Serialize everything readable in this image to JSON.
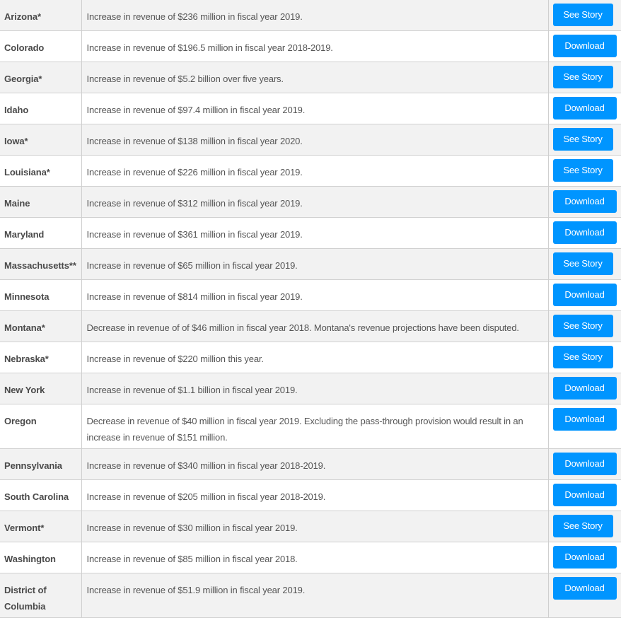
{
  "table": {
    "rows": [
      {
        "name": "Arizona*",
        "description": "Increase in revenue of $236 million in fiscal year 2019.",
        "action": "See Story"
      },
      {
        "name": "Colorado",
        "description": "Increase in revenue of $196.5 million in fiscal year 2018-2019.",
        "action": "Download"
      },
      {
        "name": "Georgia*",
        "description": "Increase in revenue of $5.2 billion over five years.",
        "action": "See Story"
      },
      {
        "name": "Idaho",
        "description": "Increase in revenue of $97.4 million in fiscal year 2019.",
        "action": "Download"
      },
      {
        "name": "Iowa*",
        "description": "Increase in revenue of $138 million in fiscal year 2020.",
        "action": "See Story"
      },
      {
        "name": "Louisiana*",
        "description": "Increase in revenue of $226 million in fiscal year 2019.",
        "action": "See Story"
      },
      {
        "name": "Maine",
        "description": "Increase in revenue of $312 million in fiscal year 2019.",
        "action": "Download"
      },
      {
        "name": "Maryland",
        "description": "Increase in revenue of $361 million in fiscal year 2019.",
        "action": "Download"
      },
      {
        "name": "Massachusetts**",
        "description": "Increase in revenue of $65 million in fiscal year 2019.",
        "action": "See Story"
      },
      {
        "name": "Minnesota",
        "description": "Increase in revenue of $814 million in fiscal year 2019.",
        "action": "Download"
      },
      {
        "name": "Montana*",
        "description": "Decrease in revenue of of $46 million in fiscal year 2018. Montana's revenue projections have been disputed.",
        "action": "See Story"
      },
      {
        "name": "Nebraska*",
        "description": "Increase in revenue of $220 million this year.",
        "action": "See Story"
      },
      {
        "name": "New York",
        "description": "Increase in revenue of $1.1 billion in fiscal year 2019.",
        "action": "Download"
      },
      {
        "name": "Oregon",
        "description": "Decrease in revenue of $40 million in fiscal year 2019. Excluding the pass-through provision would result in an increase in revenue of $151 million.",
        "action": "Download"
      },
      {
        "name": "Pennsylvania",
        "description": "Increase in revenue of $340 million in fiscal year 2018-2019.",
        "action": "Download"
      },
      {
        "name": "South Carolina",
        "description": "Increase in revenue of $205 million in fiscal year 2018-2019.",
        "action": "Download"
      },
      {
        "name": "Vermont*",
        "description": "Increase in revenue of $30 million in fiscal year 2019.",
        "action": "See Story"
      },
      {
        "name": "Washington",
        "description": "Increase in revenue of $85 million in fiscal year 2018.",
        "action": "Download"
      },
      {
        "name": "District of Columbia",
        "description": "Increase in revenue of $51.9 million in fiscal year 2019.",
        "action": "Download"
      }
    ]
  },
  "colors": {
    "button_bg": "#0095ff",
    "button_text": "#ffffff",
    "row_alt_bg": "#f2f2f2"
  }
}
